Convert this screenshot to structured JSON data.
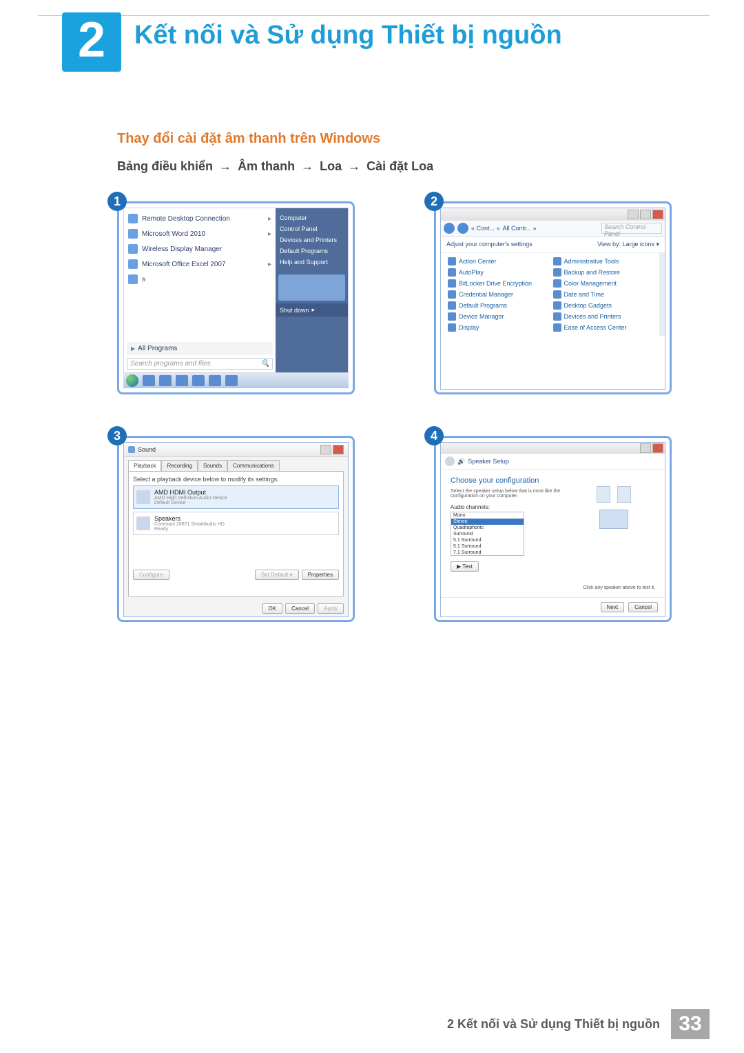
{
  "chapter": {
    "number": "2",
    "title": "Kết nối và Sử dụng Thiết bị nguồn"
  },
  "section_heading": "Thay đổi cài đặt âm thanh trên Windows",
  "path": {
    "p1": "Bảng điều khiển",
    "p2": "Âm thanh",
    "p3": "Loa",
    "p4": "Cài đặt Loa",
    "arrow": "→"
  },
  "steps": {
    "n1": "1",
    "n2": "2",
    "n3": "3",
    "n4": "4"
  },
  "start_menu": {
    "items": [
      {
        "label": "Remote Desktop Connection"
      },
      {
        "label": "Microsoft Word 2010"
      },
      {
        "label": "Wireless Display Manager"
      },
      {
        "label": "Microsoft Office Excel 2007"
      },
      {
        "label": "s"
      }
    ],
    "all_programs": "All Programs",
    "search_placeholder": "Search programs and files",
    "right": [
      "Computer",
      "Control Panel",
      "Devices and Printers",
      "Default Programs",
      "Help and Support"
    ],
    "shutdown": "Shut down"
  },
  "control_panel": {
    "crumb1": "« Cont... »",
    "crumb2": "All Contr... »",
    "search_ph": "Search Control Panel",
    "adjust": "Adjust your computer's settings",
    "viewby": "View by:   Large icons ▾",
    "items_left": [
      "Action Center",
      "AutoPlay",
      "BitLocker Drive Encryption",
      "Credential Manager",
      "Default Programs",
      "Device Manager",
      "Display"
    ],
    "items_right": [
      "Administrative Tools",
      "Backup and Restore",
      "Color Management",
      "Date and Time",
      "Desktop Gadgets",
      "Devices and Printers",
      "Ease of Access Center"
    ]
  },
  "sound": {
    "title": "Sound",
    "tabs": [
      "Playback",
      "Recording",
      "Sounds",
      "Communications"
    ],
    "hint": "Select a playback device below to modify its settings:",
    "dev1": {
      "name": "AMD HDMI Output",
      "sub1": "AMD High Definition Audio Device",
      "sub2": "Default Device"
    },
    "dev2": {
      "name": "Speakers",
      "sub1": "Conexant 20671 SmartAudio HD",
      "sub2": "Ready"
    },
    "configure": "Configure",
    "set_default": "Set Default ▾",
    "properties": "Properties",
    "ok": "OK",
    "cancel": "Cancel",
    "apply": "Apply"
  },
  "speaker_setup": {
    "crumb": "Speaker Setup",
    "heading": "Choose your configuration",
    "sub": "Select the speaker setup below that is most like the configuration on your computer.",
    "label": "Audio channels:",
    "options": [
      "Mono",
      "Stereo",
      "Quadraphonic",
      "Surround",
      "5.1 Surround",
      "5.1 Surround",
      "7.1 Surround"
    ],
    "test": "▶ Test",
    "hint_right": "Click any speaker above to test it.",
    "next": "Next",
    "cancel": "Cancel"
  },
  "footer": {
    "text": "2 Kết nối và Sử dụng Thiết bị nguồn",
    "page": "33"
  }
}
